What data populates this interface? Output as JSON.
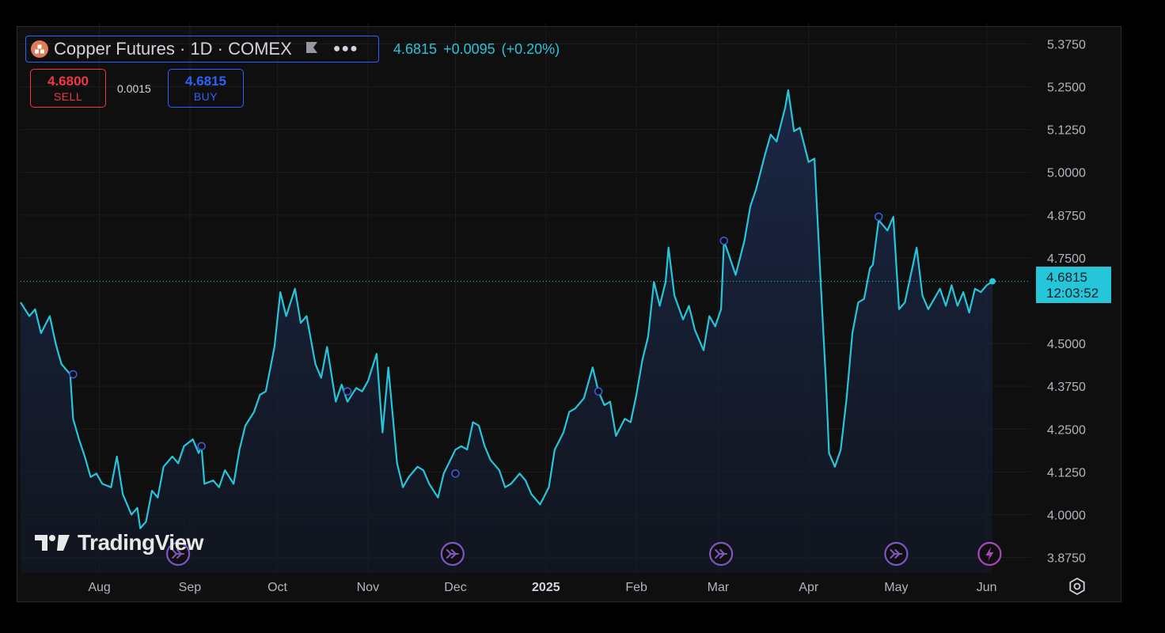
{
  "header": {
    "title": "Copper Futures · 1D · COMEX",
    "last_price": "4.6815",
    "change": "+0.0095",
    "change_pct": "(+0.20%)"
  },
  "trade": {
    "sell_price": "4.6800",
    "sell_label": "SELL",
    "spread": "0.0015",
    "buy_price": "4.6815",
    "buy_label": "BUY"
  },
  "last_tag": {
    "price": "4.6815",
    "countdown": "12:03:52"
  },
  "branding": {
    "wordmark": "TradingView"
  },
  "colors": {
    "line": "#26c6da",
    "sell": "#f23645",
    "buy": "#2962ff",
    "marker": "#7e57c2",
    "background": "#0f0f0f"
  },
  "icons": [
    "symbol-icon",
    "flag-icon",
    "more-icon",
    "event-arrow-icon",
    "lightning-icon",
    "settings-icon"
  ],
  "chart_data": {
    "type": "area",
    "title": "Copper Futures · 1D · COMEX",
    "y_ticks": [
      "5.3750",
      "5.2500",
      "5.1250",
      "5.0000",
      "4.8750",
      "4.7500",
      "4.5000",
      "4.3750",
      "4.2500",
      "4.1250",
      "4.0000",
      "3.8750"
    ],
    "x_ticks": [
      {
        "label": "Aug",
        "date": "2024-08-01"
      },
      {
        "label": "Sep",
        "date": "2024-09-01"
      },
      {
        "label": "Oct",
        "date": "2024-10-01"
      },
      {
        "label": "Nov",
        "date": "2024-11-01"
      },
      {
        "label": "Dec",
        "date": "2024-12-01"
      },
      {
        "label": "2025",
        "date": "2025-01-01"
      },
      {
        "label": "Feb",
        "date": "2025-02-01"
      },
      {
        "label": "Mar",
        "date": "2025-03-01"
      },
      {
        "label": "Apr",
        "date": "2025-04-01"
      },
      {
        "label": "May",
        "date": "2025-05-01"
      },
      {
        "label": "Jun",
        "date": "2025-06-01"
      }
    ],
    "ylim": [
      3.83,
      5.42
    ],
    "xlim": [
      "2024-07-05",
      "2025-06-16"
    ],
    "grid": true,
    "series": [
      {
        "points": [
          [
            "2024-07-05",
            4.62
          ],
          [
            "2024-07-08",
            4.58
          ],
          [
            "2024-07-10",
            4.6
          ],
          [
            "2024-07-12",
            4.53
          ],
          [
            "2024-07-15",
            4.58
          ],
          [
            "2024-07-17",
            4.5
          ],
          [
            "2024-07-19",
            4.44
          ],
          [
            "2024-07-22",
            4.41
          ],
          [
            "2024-07-23",
            4.28
          ],
          [
            "2024-07-25",
            4.22
          ],
          [
            "2024-07-27",
            4.17
          ],
          [
            "2024-07-29",
            4.11
          ],
          [
            "2024-07-31",
            4.12
          ],
          [
            "2024-08-02",
            4.09
          ],
          [
            "2024-08-05",
            4.08
          ],
          [
            "2024-08-07",
            4.17
          ],
          [
            "2024-08-09",
            4.06
          ],
          [
            "2024-08-12",
            4.0
          ],
          [
            "2024-08-14",
            4.02
          ],
          [
            "2024-08-15",
            3.96
          ],
          [
            "2024-08-17",
            3.98
          ],
          [
            "2024-08-19",
            4.07
          ],
          [
            "2024-08-21",
            4.05
          ],
          [
            "2024-08-23",
            4.14
          ],
          [
            "2024-08-26",
            4.17
          ],
          [
            "2024-08-28",
            4.15
          ],
          [
            "2024-08-30",
            4.2
          ],
          [
            "2024-09-02",
            4.22
          ],
          [
            "2024-09-04",
            4.18
          ],
          [
            "2024-09-05",
            4.2
          ],
          [
            "2024-09-06",
            4.09
          ],
          [
            "2024-09-09",
            4.1
          ],
          [
            "2024-09-11",
            4.08
          ],
          [
            "2024-09-13",
            4.13
          ],
          [
            "2024-09-16",
            4.09
          ],
          [
            "2024-09-18",
            4.19
          ],
          [
            "2024-09-20",
            4.26
          ],
          [
            "2024-09-23",
            4.3
          ],
          [
            "2024-09-25",
            4.35
          ],
          [
            "2024-09-27",
            4.36
          ],
          [
            "2024-09-30",
            4.49
          ],
          [
            "2024-10-02",
            4.65
          ],
          [
            "2024-10-04",
            4.58
          ],
          [
            "2024-10-07",
            4.66
          ],
          [
            "2024-10-09",
            4.56
          ],
          [
            "2024-10-11",
            4.58
          ],
          [
            "2024-10-14",
            4.44
          ],
          [
            "2024-10-16",
            4.4
          ],
          [
            "2024-10-18",
            4.49
          ],
          [
            "2024-10-21",
            4.33
          ],
          [
            "2024-10-23",
            4.38
          ],
          [
            "2024-10-25",
            4.33
          ],
          [
            "2024-10-28",
            4.37
          ],
          [
            "2024-10-30",
            4.36
          ],
          [
            "2024-11-01",
            4.39
          ],
          [
            "2024-11-04",
            4.47
          ],
          [
            "2024-11-06",
            4.24
          ],
          [
            "2024-11-08",
            4.43
          ],
          [
            "2024-11-11",
            4.15
          ],
          [
            "2024-11-13",
            4.08
          ],
          [
            "2024-11-15",
            4.11
          ],
          [
            "2024-11-18",
            4.14
          ],
          [
            "2024-11-20",
            4.13
          ],
          [
            "2024-11-22",
            4.09
          ],
          [
            "2024-11-25",
            4.05
          ],
          [
            "2024-11-27",
            4.12
          ],
          [
            "2024-12-01",
            4.19
          ],
          [
            "2024-12-03",
            4.2
          ],
          [
            "2024-12-05",
            4.19
          ],
          [
            "2024-12-07",
            4.27
          ],
          [
            "2024-12-09",
            4.26
          ],
          [
            "2024-12-11",
            4.2
          ],
          [
            "2024-12-13",
            4.16
          ],
          [
            "2024-12-16",
            4.13
          ],
          [
            "2024-12-18",
            4.08
          ],
          [
            "2024-12-20",
            4.09
          ],
          [
            "2024-12-23",
            4.12
          ],
          [
            "2024-12-25",
            4.1
          ],
          [
            "2024-12-27",
            4.06
          ],
          [
            "2024-12-30",
            4.03
          ],
          [
            "2025-01-02",
            4.08
          ],
          [
            "2025-01-04",
            4.19
          ],
          [
            "2025-01-07",
            4.24
          ],
          [
            "2025-01-09",
            4.3
          ],
          [
            "2025-01-11",
            4.31
          ],
          [
            "2025-01-14",
            4.34
          ],
          [
            "2025-01-16",
            4.4
          ],
          [
            "2025-01-17",
            4.43
          ],
          [
            "2025-01-19",
            4.36
          ],
          [
            "2025-01-21",
            4.32
          ],
          [
            "2025-01-23",
            4.33
          ],
          [
            "2025-01-25",
            4.23
          ],
          [
            "2025-01-28",
            4.28
          ],
          [
            "2025-01-30",
            4.27
          ],
          [
            "2025-02-01",
            4.35
          ],
          [
            "2025-02-03",
            4.45
          ],
          [
            "2025-02-05",
            4.52
          ],
          [
            "2025-02-07",
            4.68
          ],
          [
            "2025-02-09",
            4.61
          ],
          [
            "2025-02-11",
            4.68
          ],
          [
            "2025-02-12",
            4.78
          ],
          [
            "2025-02-14",
            4.64
          ],
          [
            "2025-02-17",
            4.57
          ],
          [
            "2025-02-19",
            4.61
          ],
          [
            "2025-02-21",
            4.54
          ],
          [
            "2025-02-24",
            4.48
          ],
          [
            "2025-02-26",
            4.58
          ],
          [
            "2025-02-28",
            4.55
          ],
          [
            "2025-03-02",
            4.6
          ],
          [
            "2025-03-03",
            4.8
          ],
          [
            "2025-03-05",
            4.75
          ],
          [
            "2025-03-07",
            4.7
          ],
          [
            "2025-03-10",
            4.8
          ],
          [
            "2025-03-12",
            4.9
          ],
          [
            "2025-03-14",
            4.95
          ],
          [
            "2025-03-17",
            5.05
          ],
          [
            "2025-03-19",
            5.11
          ],
          [
            "2025-03-21",
            5.09
          ],
          [
            "2025-03-24",
            5.19
          ],
          [
            "2025-03-25",
            5.24
          ],
          [
            "2025-03-27",
            5.12
          ],
          [
            "2025-03-29",
            5.13
          ],
          [
            "2025-04-01",
            5.03
          ],
          [
            "2025-04-03",
            5.04
          ],
          [
            "2025-04-05",
            4.7
          ],
          [
            "2025-04-07",
            4.38
          ],
          [
            "2025-04-08",
            4.18
          ],
          [
            "2025-04-10",
            4.14
          ],
          [
            "2025-04-12",
            4.19
          ],
          [
            "2025-04-14",
            4.34
          ],
          [
            "2025-04-16",
            4.53
          ],
          [
            "2025-04-18",
            4.62
          ],
          [
            "2025-04-20",
            4.63
          ],
          [
            "2025-04-22",
            4.72
          ],
          [
            "2025-04-23",
            4.73
          ],
          [
            "2025-04-25",
            4.86
          ],
          [
            "2025-04-28",
            4.83
          ],
          [
            "2025-04-30",
            4.87
          ],
          [
            "2025-05-02",
            4.6
          ],
          [
            "2025-05-04",
            4.62
          ],
          [
            "2025-05-06",
            4.7
          ],
          [
            "2025-05-08",
            4.78
          ],
          [
            "2025-05-10",
            4.64
          ],
          [
            "2025-05-12",
            4.6
          ],
          [
            "2025-05-14",
            4.63
          ],
          [
            "2025-05-16",
            4.66
          ],
          [
            "2025-05-18",
            4.61
          ],
          [
            "2025-05-20",
            4.67
          ],
          [
            "2025-05-22",
            4.61
          ],
          [
            "2025-05-24",
            4.65
          ],
          [
            "2025-05-26",
            4.59
          ],
          [
            "2025-05-28",
            4.66
          ],
          [
            "2025-05-30",
            4.65
          ],
          [
            "2025-06-01",
            4.67
          ],
          [
            "2025-06-03",
            4.6815
          ]
        ]
      }
    ],
    "point_markers": [
      [
        "2024-07-23",
        4.41
      ],
      [
        "2024-09-05",
        4.2
      ],
      [
        "2024-10-25",
        4.36
      ],
      [
        "2024-12-01",
        4.12
      ],
      [
        "2025-01-19",
        4.36
      ],
      [
        "2025-03-03",
        4.8
      ],
      [
        "2025-04-25",
        4.87
      ]
    ],
    "event_markers": [
      {
        "date": "2024-08-28",
        "icon": "event-arrow-icon"
      },
      {
        "date": "2024-11-30",
        "icon": "event-arrow-icon"
      },
      {
        "date": "2025-03-02",
        "icon": "event-arrow-icon"
      },
      {
        "date": "2025-05-01",
        "icon": "event-arrow-icon"
      },
      {
        "date": "2025-06-02",
        "icon": "lightning-icon"
      }
    ],
    "last_value": 4.6815
  }
}
